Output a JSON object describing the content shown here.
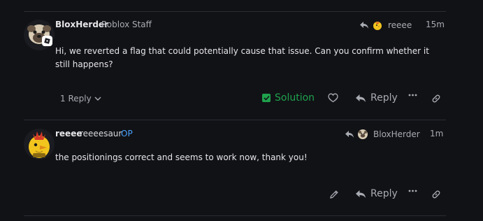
{
  "posts": [
    {
      "author": "BloxHerder",
      "title": "Roblox Staff",
      "reply_to": "reeee",
      "time": "15m",
      "body": "Hi, we reverted a flag that could potentially cause that issue. Can you confirm whether it still happens?",
      "replies_label": "1 Reply",
      "solution_label": "Solution",
      "reply_label": "Reply"
    },
    {
      "author": "reeee",
      "username": "reeeesaur",
      "op_label": "OP",
      "reply_to": "BloxHerder",
      "time": "1m",
      "body": "the positionings correct and seems to work now, thank you!",
      "reply_label": "Reply"
    }
  ],
  "colors": {
    "background": "#111216",
    "accent_blue": "#4aa3ff",
    "solution_green": "#1fa14d"
  }
}
